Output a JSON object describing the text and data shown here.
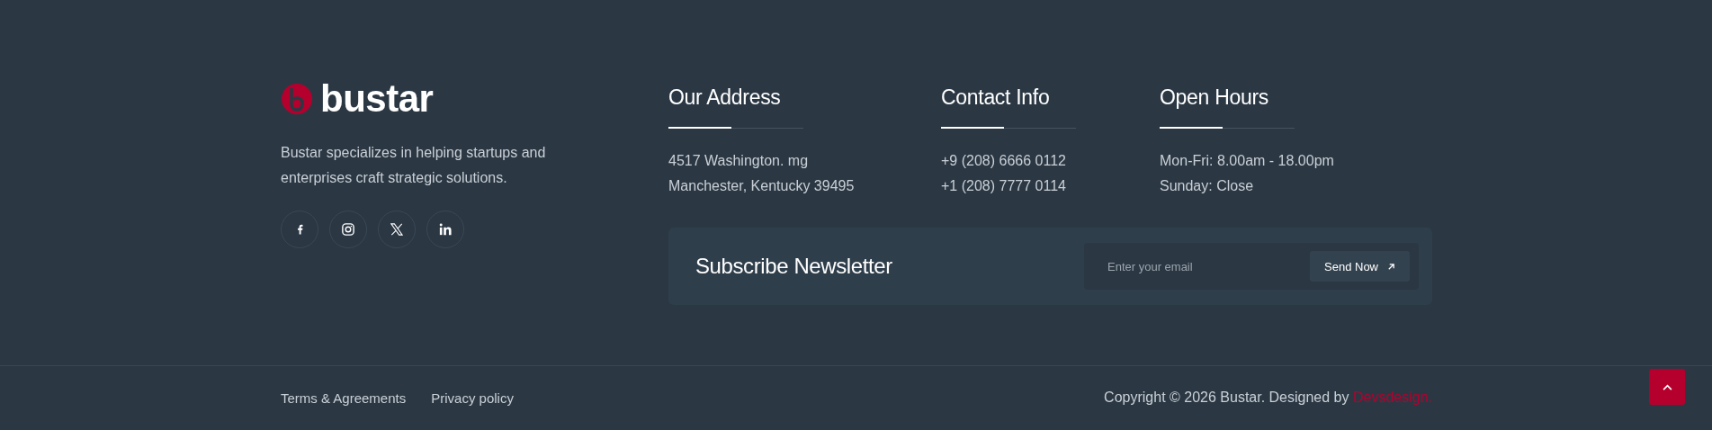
{
  "brand": {
    "name": "bustar",
    "description": "Bustar specializes in helping startups and enterprises craft strategic solutions."
  },
  "social": [
    {
      "kind": "facebook"
    },
    {
      "kind": "instagram"
    },
    {
      "kind": "x"
    },
    {
      "kind": "linkedin"
    }
  ],
  "columns": [
    {
      "title": "Our Address",
      "lines": [
        "4517 Washington. mg",
        "Manchester, Kentucky 39495"
      ]
    },
    {
      "title": "Contact Info",
      "lines": [
        "+9 (208) 6666 0112",
        "+1 (208) 7777 0114"
      ]
    },
    {
      "title": "Open Hours",
      "lines": [
        "Mon-Fri: 8.00am - 18.00pm",
        "Sunday: Close"
      ]
    }
  ],
  "newsletter": {
    "title": "Subscribe Newsletter",
    "placeholder": "Enter your email",
    "button": "Send Now"
  },
  "bottom_links": [
    "Terms & Agreements",
    "Privacy policy"
  ],
  "copyright": {
    "text": "Copyright © 2026 Bustar. Designed by",
    "link": "Devsdesign."
  }
}
